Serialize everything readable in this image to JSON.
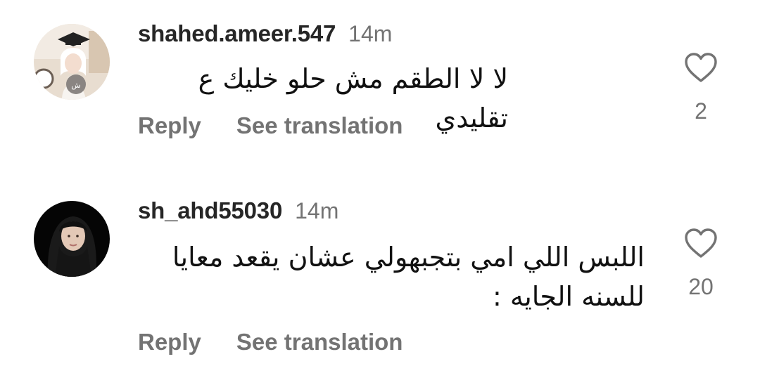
{
  "comments": [
    {
      "username": "shahed.ameer.547",
      "time": "14m",
      "text": "لا لا الطقم مش حلو خليك ع تقليدي",
      "reply_label": "Reply",
      "translate_label": "See translation",
      "like_count": "2",
      "like_icon": "heart-outline"
    },
    {
      "username": "sh_ahd55030",
      "time": "14m",
      "text": "اللبس اللي امي بتجبهولي عشان يقعد معايا للسنه الجايه :",
      "reply_label": "Reply",
      "translate_label": "See translation",
      "like_count": "20",
      "like_icon": "heart-outline"
    }
  ],
  "colors": {
    "primary_text": "#262626",
    "secondary_text": "#737373",
    "background": "#ffffff"
  }
}
